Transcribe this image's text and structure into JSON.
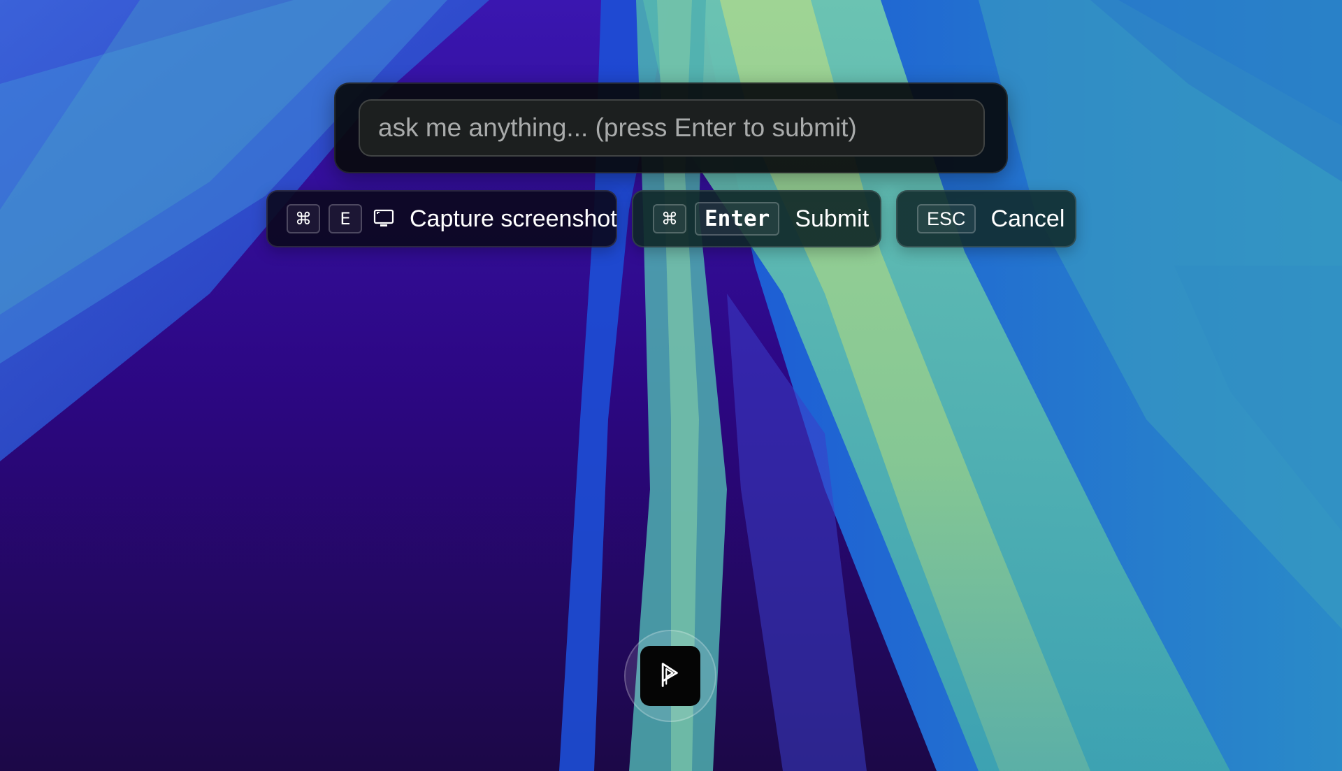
{
  "prompt": {
    "placeholder": "ask me anything... (press Enter to submit)"
  },
  "shortcuts": {
    "capture": {
      "keys": [
        "⌘",
        "E"
      ],
      "icon": "screen-icon",
      "label": "Capture screenshot"
    },
    "submit": {
      "keys": [
        "⌘",
        "Enter"
      ],
      "label": "Submit"
    },
    "cancel": {
      "keys": [
        "ESC"
      ],
      "label": "Cancel"
    }
  },
  "dock": {
    "app_icon": "app-logo-icon"
  },
  "colors": {
    "wallpaper_purple": "#2a0a7a",
    "wallpaper_blue": "#1a4fd0",
    "wallpaper_teal": "#4fb3a8",
    "wallpaper_green": "#8ccb8f",
    "panel_bg": "#0a0c0e",
    "input_bg": "#1c1f1f"
  }
}
